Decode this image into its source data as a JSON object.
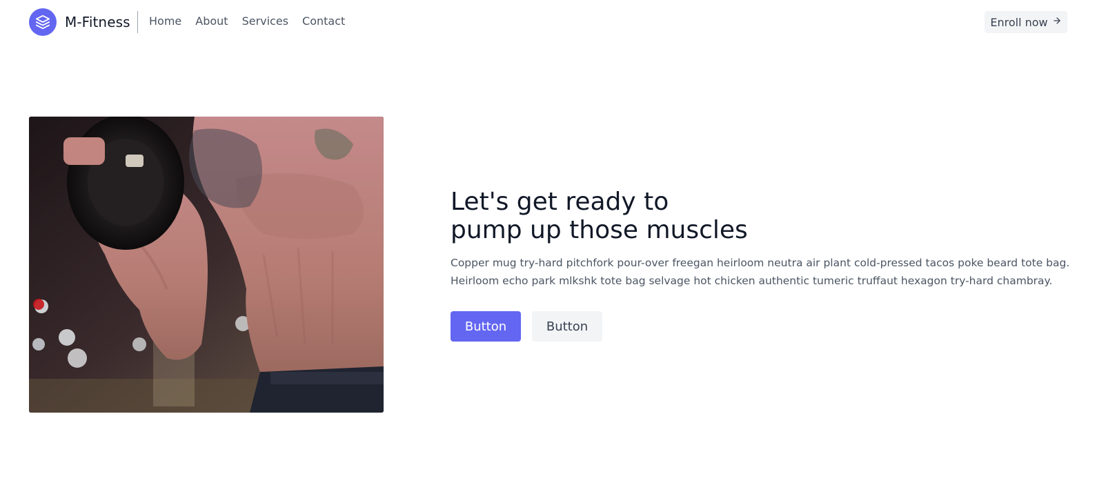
{
  "brand": {
    "name": "M-Fitness",
    "logo_icon": "stacked-layers-icon",
    "accent_color": "#6366f1"
  },
  "nav": {
    "items": [
      {
        "label": "Home"
      },
      {
        "label": "About"
      },
      {
        "label": "Services"
      },
      {
        "label": "Contact"
      }
    ]
  },
  "header": {
    "cta_label": "Enroll now",
    "cta_icon": "arrow-right-icon"
  },
  "hero": {
    "image": "muscular tattooed man lifting a dumbbell in a gym",
    "title_line1": "Let's get ready to",
    "title_line2": "pump up those muscles",
    "description_line1": "Copper mug try-hard pitchfork pour-over freegan heirloom neutra air plant cold-pressed tacos poke beard tote bag.",
    "description_line2": "Heirloom echo park mlkshk tote bag selvage hot chicken authentic tumeric truffaut hexagon try-hard chambray.",
    "primary_button": "Button",
    "secondary_button": "Button"
  }
}
